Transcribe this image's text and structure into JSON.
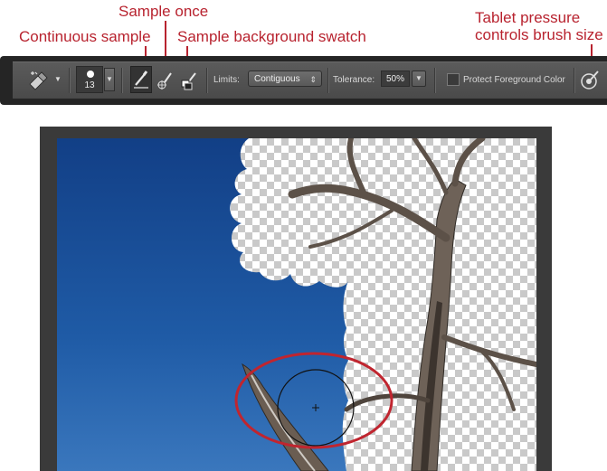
{
  "callouts": {
    "sample_once": "Sample once",
    "continuous_sample": "Continuous sample",
    "sample_background": "Sample background swatch",
    "tablet_pressure_1": "Tablet pressure",
    "tablet_pressure_2": "controls brush size"
  },
  "toolbar": {
    "brush_size": "13",
    "limits_label": "Limits:",
    "limits_value": "Contiguous",
    "tolerance_label": "Tolerance:",
    "tolerance_value": "50%",
    "protect_label": "Protect Foreground Color"
  },
  "colors": {
    "accent": "#b8232f",
    "sky": "#1a4f97",
    "toolbar": "#4f4f4f"
  },
  "icons": [
    "background-eraser-tool-icon",
    "brush-preset-icon",
    "continuous-sample-icon",
    "sample-once-icon",
    "sample-background-swatch-icon",
    "tablet-pressure-icon"
  ]
}
